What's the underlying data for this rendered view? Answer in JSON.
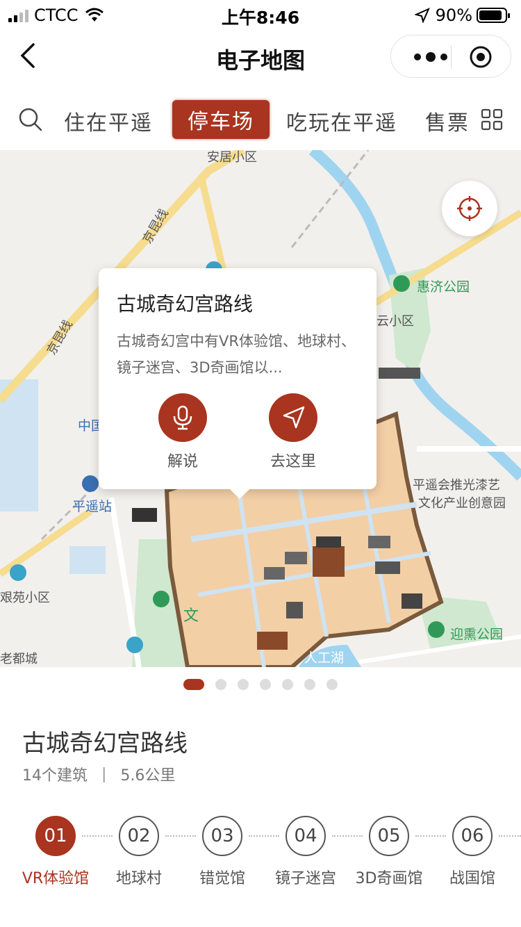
{
  "status_bar": {
    "carrier": "CTCC",
    "time": "上午8:46",
    "battery": "90%"
  },
  "nav": {
    "title": "电子地图"
  },
  "tabs": [
    {
      "label": "住在平遥",
      "active": false
    },
    {
      "label": "停车场",
      "active": true
    },
    {
      "label": "吃玩在平遥",
      "active": false
    },
    {
      "label": "售票",
      "active": false
    }
  ],
  "map": {
    "labels": {
      "anju": "安居小区",
      "jingkun1": "京昆线",
      "jingkun2": "京昆线",
      "huiji": "惠济公园",
      "yunxiaoqu": "云小区",
      "zhongguo": "中国",
      "pingyao_station": "平遥站",
      "yuanxiaoqu": "艰苑小区",
      "ducheng": "老都城",
      "tuiguang1": "平遥会推光漆艺",
      "tuiguang2": "文化产业创意园",
      "yingxun": "迎熏公园",
      "rengong": "人工湖",
      "wen": "文"
    }
  },
  "popup": {
    "title": "古城奇幻宫路线",
    "description": "古城奇幻宫中有VR体验馆、地球村、镜子迷宫、3D奇画馆以...",
    "explain_label": "解说",
    "goto_label": "去这里"
  },
  "carousel": {
    "count": 7,
    "active_index": 0
  },
  "route": {
    "title": "古城奇幻宫路线",
    "buildings": "14个建筑",
    "distance": "5.6公里",
    "stops": [
      {
        "num": "01",
        "name": "VR体验馆",
        "active": true
      },
      {
        "num": "02",
        "name": "地球村",
        "active": false
      },
      {
        "num": "03",
        "name": "错觉馆",
        "active": false
      },
      {
        "num": "04",
        "name": "镜子迷宫",
        "active": false
      },
      {
        "num": "05",
        "name": "3D奇画馆",
        "active": false
      },
      {
        "num": "06",
        "name": "战国馆",
        "active": false
      }
    ]
  },
  "colors": {
    "accent": "#a9341f",
    "wall": "#f3cfa6",
    "park": "#cfe8cf",
    "water": "#9fd4f0"
  }
}
